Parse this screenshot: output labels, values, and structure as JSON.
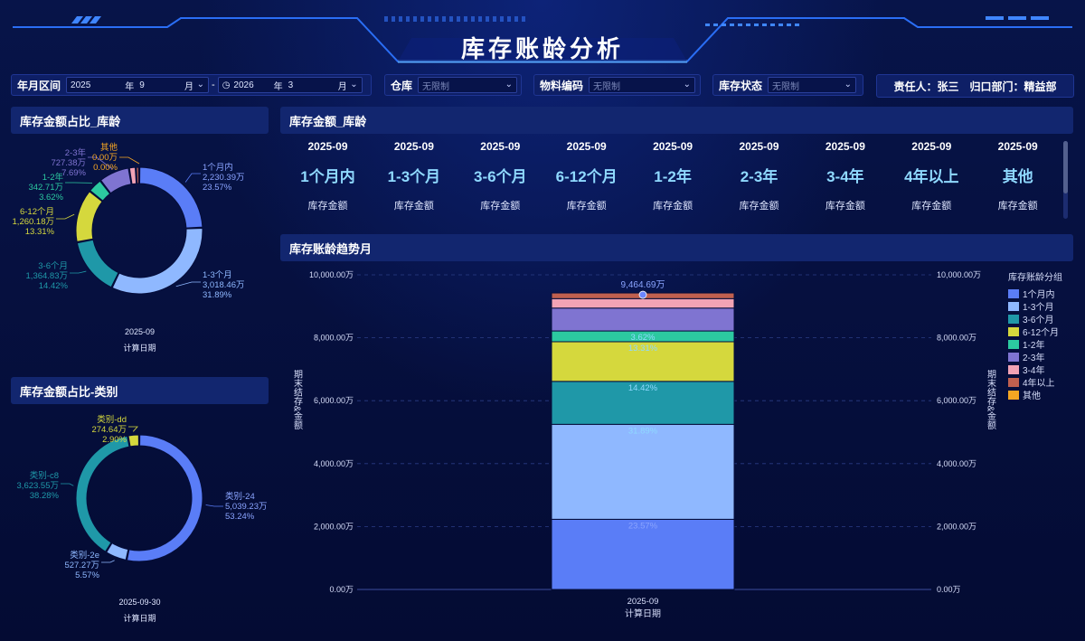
{
  "title": "库存账龄分析",
  "filters": {
    "period_label": "年月区间",
    "start_year": "2025",
    "year_unit": "年",
    "start_month": "9",
    "month_unit": "月",
    "range_sep": "-",
    "end_year": "2026",
    "end_month": "3",
    "warehouse_label": "仓库",
    "warehouse_placeholder": "无限制",
    "material_label": "物料编码",
    "material_placeholder": "无限制",
    "status_label": "库存状态",
    "status_placeholder": "无限制",
    "responsible": "责任人：张三",
    "department": "归口部门：精益部"
  },
  "panels": {
    "age_donut_title": "库存金额占比_库龄",
    "category_donut_title": "库存金额占比-类别",
    "age_table_title": "库存金额_库龄",
    "trend_title": "库存账龄趋势月"
  },
  "age_donut": {
    "date": "2025-09",
    "caption": "计算日期",
    "slices": [
      {
        "name": "1个月内",
        "value": "2,230.39万",
        "pct": "23.57%",
        "amount": 2230.39,
        "color": "#5a7df7"
      },
      {
        "name": "1-3个月",
        "value": "3,018.46万",
        "pct": "31.89%",
        "amount": 3018.46,
        "color": "#8fb8ff"
      },
      {
        "name": "3-6个月",
        "value": "1,364.83万",
        "pct": "14.42%",
        "amount": 1364.83,
        "color": "#1f98a8"
      },
      {
        "name": "6-12个月",
        "value": "1,260.18万",
        "pct": "13.31%",
        "amount": 1260.18,
        "color": "#d5d83d"
      },
      {
        "name": "1-2年",
        "value": "342.71万",
        "pct": "3.62%",
        "amount": 342.71,
        "color": "#2cc9a0"
      },
      {
        "name": "2-3年",
        "value": "727.38万",
        "pct": "7.69%",
        "amount": 727.38,
        "color": "#7f74d1"
      },
      {
        "name": "其他",
        "value": "0.00万",
        "pct": "0.00%",
        "amount": 0,
        "color": "#f5a623"
      }
    ],
    "extra_slice": {
      "name": "4年以上",
      "amount": 80,
      "color": "#c0604f"
    }
  },
  "category_donut": {
    "date": "2025-09-30",
    "caption": "计算日期",
    "slices": [
      {
        "name": "类别-24",
        "value": "5,039.23万",
        "pct": "53.24%",
        "amount": 5039.23,
        "color": "#5a7df7"
      },
      {
        "name": "类别-2e",
        "value": "527.27万",
        "pct": "5.57%",
        "amount": 527.27,
        "color": "#8fb8ff"
      },
      {
        "name": "类别-c8",
        "value": "3,623.55万",
        "pct": "38.28%",
        "amount": 3623.55,
        "color": "#1f98a8"
      },
      {
        "name": "类别-dd",
        "value": "274.64万",
        "pct": "2.90%",
        "amount": 274.64,
        "color": "#d5d83d"
      }
    ]
  },
  "age_table": {
    "period": "2025-09",
    "metric": "库存金额",
    "columns": [
      "1个月内",
      "1-3个月",
      "3-6个月",
      "6-12个月",
      "1-2年",
      "2-3年",
      "3-4年",
      "4年以上",
      "其他"
    ]
  },
  "chart_data": {
    "type": "bar",
    "stacked": true,
    "categories": [
      "2025-09"
    ],
    "xlabel": "计算日期",
    "ylabel": "期末结存&金额",
    "ylim": [
      0,
      10000
    ],
    "yticks": [
      "0.00万",
      "2,000.00万",
      "4,000.00万",
      "6,000.00万",
      "8,000.00万",
      "10,000.00万"
    ],
    "total_label": "9,464.69万",
    "legend_title": "库存账龄分组",
    "legend_position": "right",
    "series": [
      {
        "name": "1个月内",
        "values": [
          2230.39
        ],
        "label": "23.57%",
        "color": "#5a7df7"
      },
      {
        "name": "1-3个月",
        "values": [
          3018.46
        ],
        "label": "31.89%",
        "color": "#8fb8ff"
      },
      {
        "name": "3-6个月",
        "values": [
          1364.83
        ],
        "label": "14.42%",
        "color": "#1f98a8"
      },
      {
        "name": "6-12个月",
        "values": [
          1260.18
        ],
        "label": "13.31%",
        "color": "#d5d83d"
      },
      {
        "name": "1-2年",
        "values": [
          342.71
        ],
        "label": "3.62%",
        "color": "#2cc9a0"
      },
      {
        "name": "2-3年",
        "values": [
          727.38
        ],
        "label": "",
        "color": "#7f74d1"
      },
      {
        "name": "3-4年",
        "values": [
          300
        ],
        "label": "",
        "color": "#f2a3b5"
      },
      {
        "name": "4年以上",
        "values": [
          180
        ],
        "label": "",
        "color": "#c0604f"
      },
      {
        "name": "其他",
        "values": [
          0
        ],
        "label": "",
        "color": "#f5a623"
      }
    ]
  }
}
